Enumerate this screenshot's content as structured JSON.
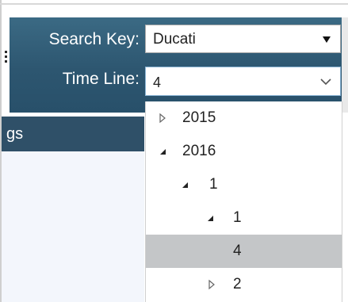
{
  "filter": {
    "search_key_label": "Search Key:",
    "search_key_value": "Ducati",
    "time_line_label": "Time Line:",
    "time_line_value": "4"
  },
  "grid": {
    "header_label": "gs"
  },
  "timeline_tree": {
    "items": [
      {
        "label": "2015",
        "state": "collapsed",
        "level": 0
      },
      {
        "label": "2016",
        "state": "expanded",
        "level": 0
      },
      {
        "label": "1",
        "state": "expanded",
        "level": 1
      },
      {
        "label": "1",
        "state": "expanded",
        "level": 2
      },
      {
        "label": "4",
        "state": "leaf",
        "level": 3,
        "selected": true
      },
      {
        "label": "2",
        "state": "collapsed",
        "level": 2
      }
    ]
  },
  "colors": {
    "panel_bg": "#2f5a72",
    "grid_header_bg": "#2f5068",
    "selected_row_bg": "#c4c6c8",
    "grid_body_bg": "#f3f6fc"
  },
  "icons": {
    "collapsed": "triangle-right-outline-icon",
    "expanded": "triangle-down-filled-icon",
    "dropdown": "caret-down-icon",
    "combo": "chevron-down-icon"
  }
}
